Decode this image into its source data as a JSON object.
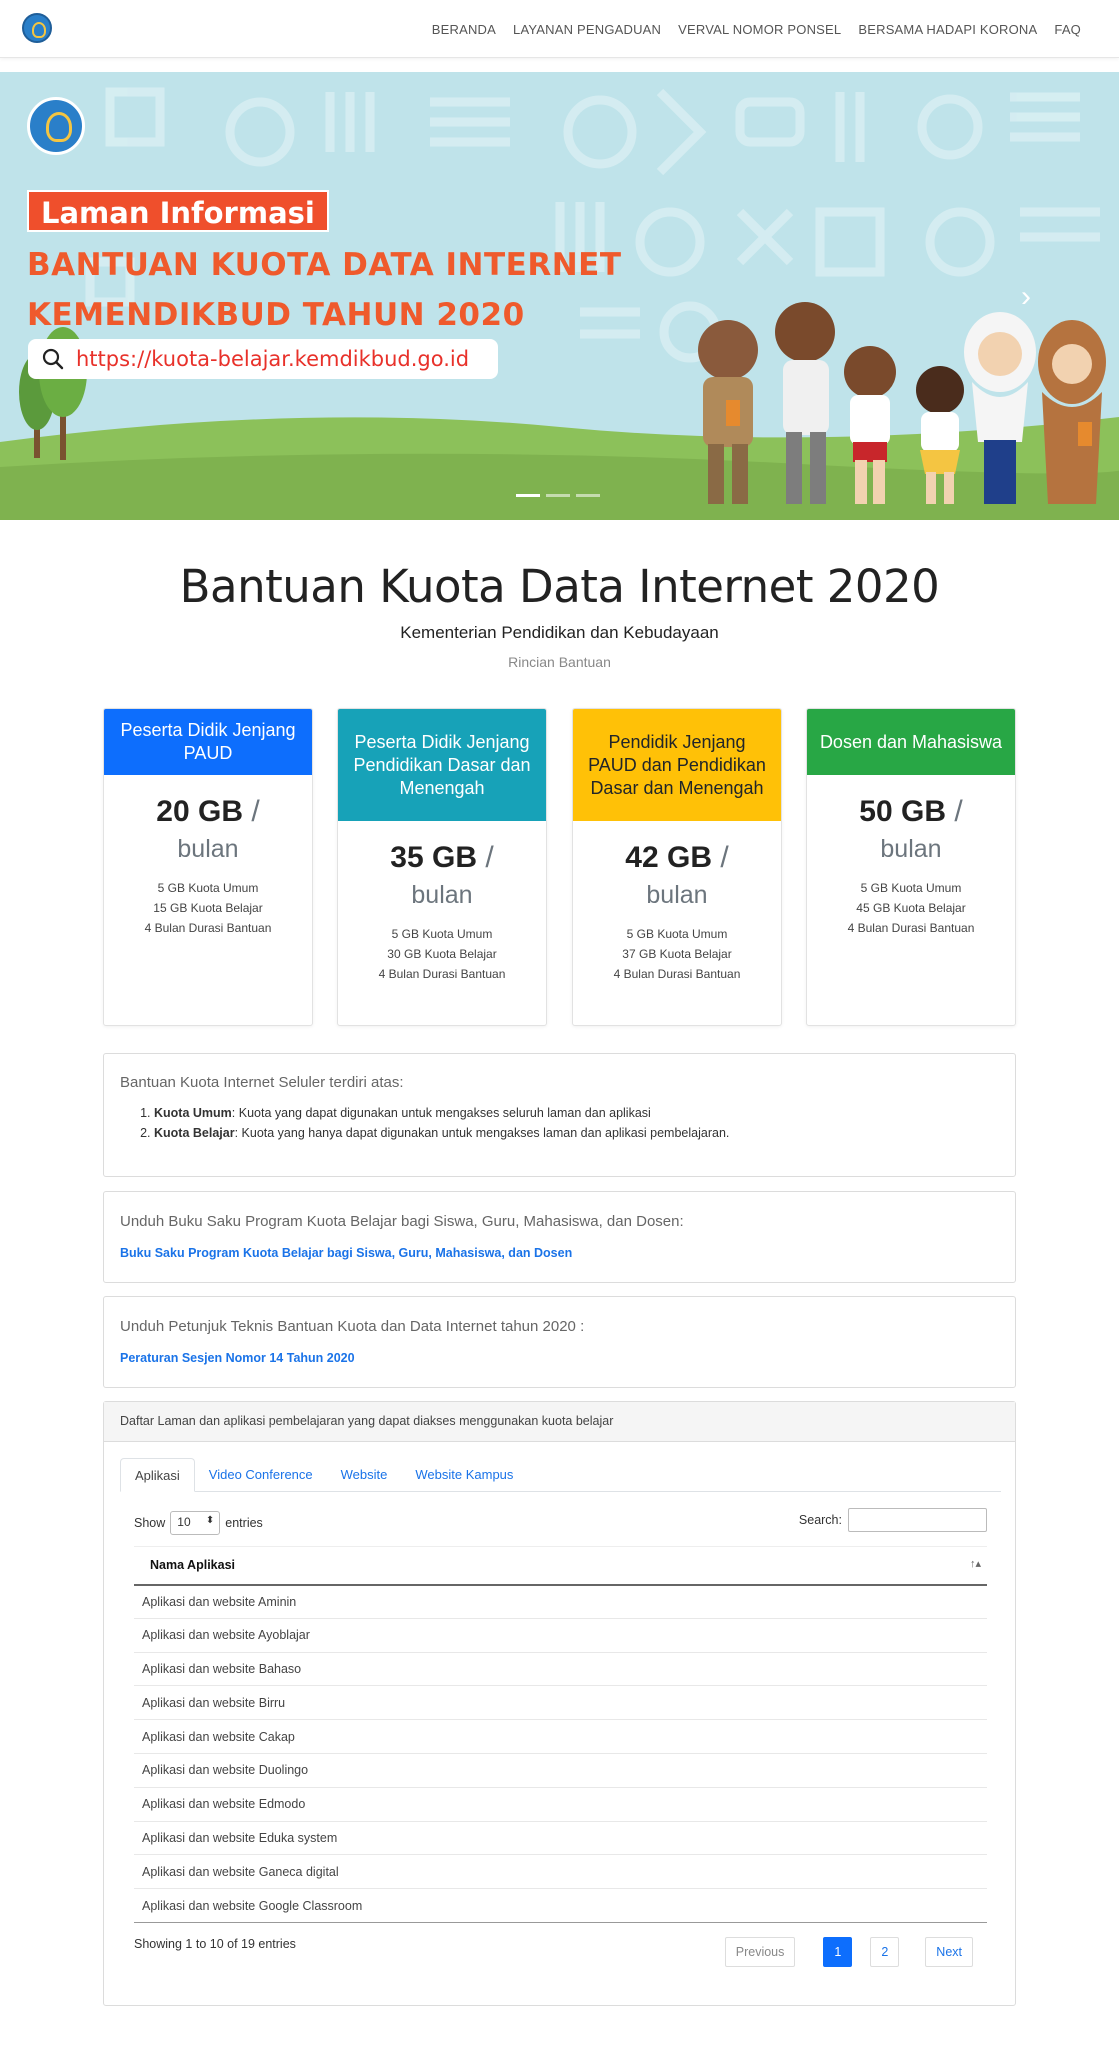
{
  "nav": {
    "items": [
      "BERANDA",
      "LAYANAN PENGADUAN",
      "VERVAL NOMOR PONSEL",
      "BERSAMA HADAPI KORONA",
      "FAQ"
    ]
  },
  "hero": {
    "tag": "Laman Informasi",
    "title_line1": "BANTUAN KUOTA DATA INTERNET",
    "title_line2": "KEMENDIKBUD TAHUN 2020",
    "url": "https://kuota-belajar.kemdikbud.go.id",
    "colors": {
      "sky": "#bfe3ea",
      "grass": "#8cc15a",
      "accent": "#ef4f2c"
    }
  },
  "main": {
    "title": "Bantuan Kuota Data Internet 2020",
    "subtitle": "Kementerian Pendidikan dan Kebudayaan",
    "section": "Rincian Bantuan"
  },
  "cards": [
    {
      "header": "Peserta Didik Jenjang PAUD",
      "amount": "20 GB",
      "per": "/",
      "unit": "bulan",
      "items": [
        "5 GB Kuota Umum",
        "15 GB Kuota Belajar",
        "4 Bulan Durasi Bantuan"
      ],
      "color": "#0d6efd",
      "text_color": "#ffffff"
    },
    {
      "header": "Peserta Didik Jenjang Pendidikan Dasar dan Menengah",
      "amount": "35 GB",
      "per": "/",
      "unit": "bulan",
      "items": [
        "5 GB Kuota Umum",
        "30 GB Kuota Belajar",
        "4 Bulan Durasi Bantuan"
      ],
      "color": "#17a2b8",
      "text_color": "#ffffff"
    },
    {
      "header": "Pendidik Jenjang PAUD dan Pendidikan Dasar dan Menengah",
      "amount": "42 GB",
      "per": "/",
      "unit": "bulan",
      "items": [
        "5 GB Kuota Umum",
        "37 GB Kuota Belajar",
        "4 Bulan Durasi Bantuan"
      ],
      "color": "#ffc107",
      "text_color": "#212529"
    },
    {
      "header": "Dosen dan Mahasiswa",
      "amount": "50 GB",
      "per": "/",
      "unit": "bulan",
      "items": [
        "5 GB Kuota Umum",
        "45 GB Kuota Belajar",
        "4 Bulan Durasi Bantuan"
      ],
      "color": "#28a745",
      "text_color": "#ffffff"
    }
  ],
  "info_box": {
    "heading": "Bantuan Kuota Internet Seluler terdiri atas:",
    "items": [
      {
        "term": "Kuota Umum",
        "desc": ": Kuota yang dapat digunakan untuk mengakses seluruh laman dan aplikasi"
      },
      {
        "term": "Kuota Belajar",
        "desc": ": Kuota yang hanya dapat digunakan untuk mengakses laman dan aplikasi pembelajaran."
      }
    ]
  },
  "download_box": {
    "heading": "Unduh Buku Saku Program Kuota Belajar bagi Siswa, Guru, Mahasiswa, dan Dosen:",
    "link": "Buku Saku Program Kuota Belajar bagi Siswa, Guru, Mahasiswa, dan Dosen"
  },
  "technical_box": {
    "heading": "Unduh Petunjuk Teknis Bantuan Kuota dan Data Internet tahun 2020 :",
    "link": "Peraturan Sesjen Nomor 14 Tahun 2020"
  },
  "table_card": {
    "header": "Daftar Laman dan aplikasi pembelajaran yang dapat diakses menggunakan kuota belajar",
    "tabs": [
      "Aplikasi",
      "Video Conference",
      "Website",
      "Website Kampus"
    ],
    "show_label": "Show",
    "show_value": "10",
    "entries_label": "entries",
    "search_label": "Search:",
    "column": "Nama Aplikasi",
    "sort_icon": "↑▴",
    "rows": [
      "Aplikasi dan website Aminin",
      "Aplikasi dan website Ayoblajar",
      "Aplikasi dan website Bahaso",
      "Aplikasi dan website Birru",
      "Aplikasi dan website Cakap",
      "Aplikasi dan website Duolingo",
      "Aplikasi dan website Edmodo",
      "Aplikasi dan website Eduka system",
      "Aplikasi dan website Ganeca digital",
      "Aplikasi dan website Google Classroom"
    ],
    "info": "Showing 1 to 10 of 19 entries",
    "pagination": {
      "previous": "Previous",
      "pages": [
        "1",
        "2"
      ],
      "next": "Next",
      "current": "1"
    }
  }
}
